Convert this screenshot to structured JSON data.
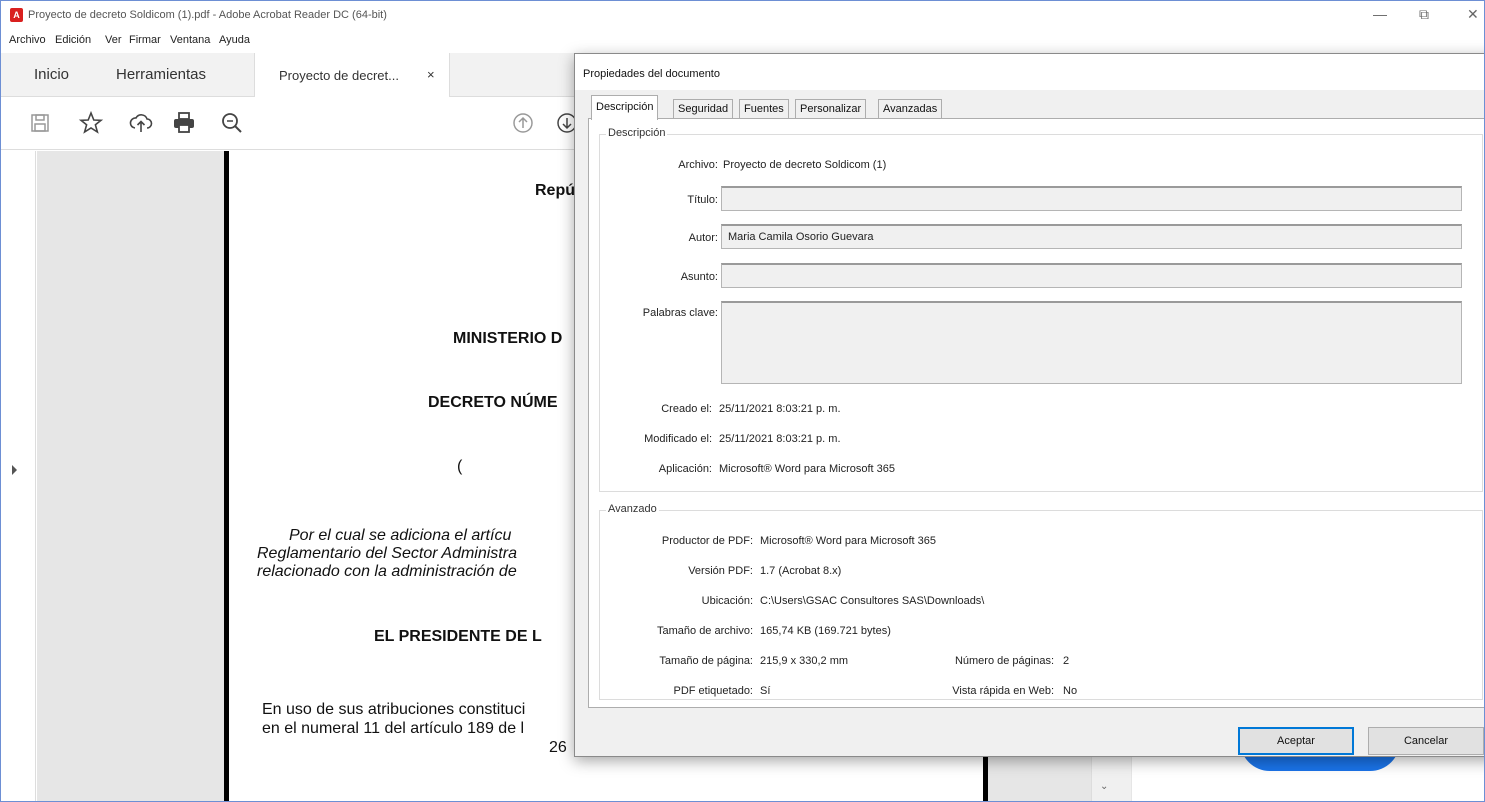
{
  "window": {
    "title": "Proyecto de decreto Soldicom (1).pdf - Adobe Acrobat Reader DC (64-bit)",
    "icon": "acrobat-icon",
    "controls": [
      "minimize-icon",
      "restore-icon",
      "close-icon"
    ]
  },
  "menubar": [
    "Archivo",
    "Edición",
    "Ver",
    "Firmar",
    "Ventana",
    "Ayuda"
  ],
  "nav_tabs": {
    "home": "Inicio",
    "tools": "Herramientas",
    "document": "Proyecto de decret...",
    "document_close": "×"
  },
  "toolbar_icons": [
    "save-icon",
    "star-icon",
    "upload-icon",
    "print-icon",
    "zoom-search-icon",
    "page-up-icon",
    "page-down-icon"
  ],
  "document_lines": {
    "l1": "Repú",
    "l2": "MINISTERIO D",
    "l3": "DECRETO NÚME",
    "l4": "(",
    "l5": "Por el cual se adiciona el artícu",
    "l6": "Reglamentario del Sector Administra",
    "l7": "relacionado con la administración de",
    "l8": "EL PRESIDENTE DE L",
    "l9": "En uso de sus atribuciones constituci",
    "l10": "en el numeral 11 del artículo 189 de l",
    "l11": "26"
  },
  "dialog": {
    "title": "Propiedades del documento",
    "tabs": [
      "Descripción",
      "Seguridad",
      "Fuentes",
      "Personalizar",
      "Avanzadas"
    ],
    "active_tab": "Descripción",
    "description": {
      "legend": "Descripción",
      "file_label": "Archivo:",
      "file_value": "Proyecto de decreto Soldicom (1)",
      "title_label": "Título:",
      "title_value": "",
      "author_label": "Autor:",
      "author_value": "Maria Camila Osorio Guevara",
      "subject_label": "Asunto:",
      "subject_value": "",
      "keywords_label": "Palabras clave:",
      "keywords_value": "",
      "created_label": "Creado el:",
      "created_value": "25/11/2021 8:03:21 p. m.",
      "modified_label": "Modificado el:",
      "modified_value": "25/11/2021 8:03:21 p. m.",
      "app_label": "Aplicación:",
      "app_value": "Microsoft® Word para Microsoft 365"
    },
    "advanced": {
      "legend": "Avanzado",
      "producer_label": "Productor de PDF:",
      "producer_value": "Microsoft® Word para Microsoft 365",
      "version_label": "Versión PDF:",
      "version_value": "1.7 (Acrobat 8.x)",
      "location_label": "Ubicación:",
      "location_value": "C:\\Users\\GSAC Consultores SAS\\Downloads\\",
      "filesize_label": "Tamaño de archivo:",
      "filesize_value": "165,74 KB (169.721 bytes)",
      "pagesize_label": "Tamaño de página:",
      "pagesize_value": "215,9 x 330,2 mm",
      "pagecount_label": "Número de páginas:",
      "pagecount_value": "2",
      "tagged_label": "PDF etiquetado:",
      "tagged_value": "Sí",
      "fastweb_label": "Vista rápida en Web:",
      "fastweb_value": "No"
    },
    "ok_label": "Aceptar",
    "cancel_label": "Cancelar"
  }
}
